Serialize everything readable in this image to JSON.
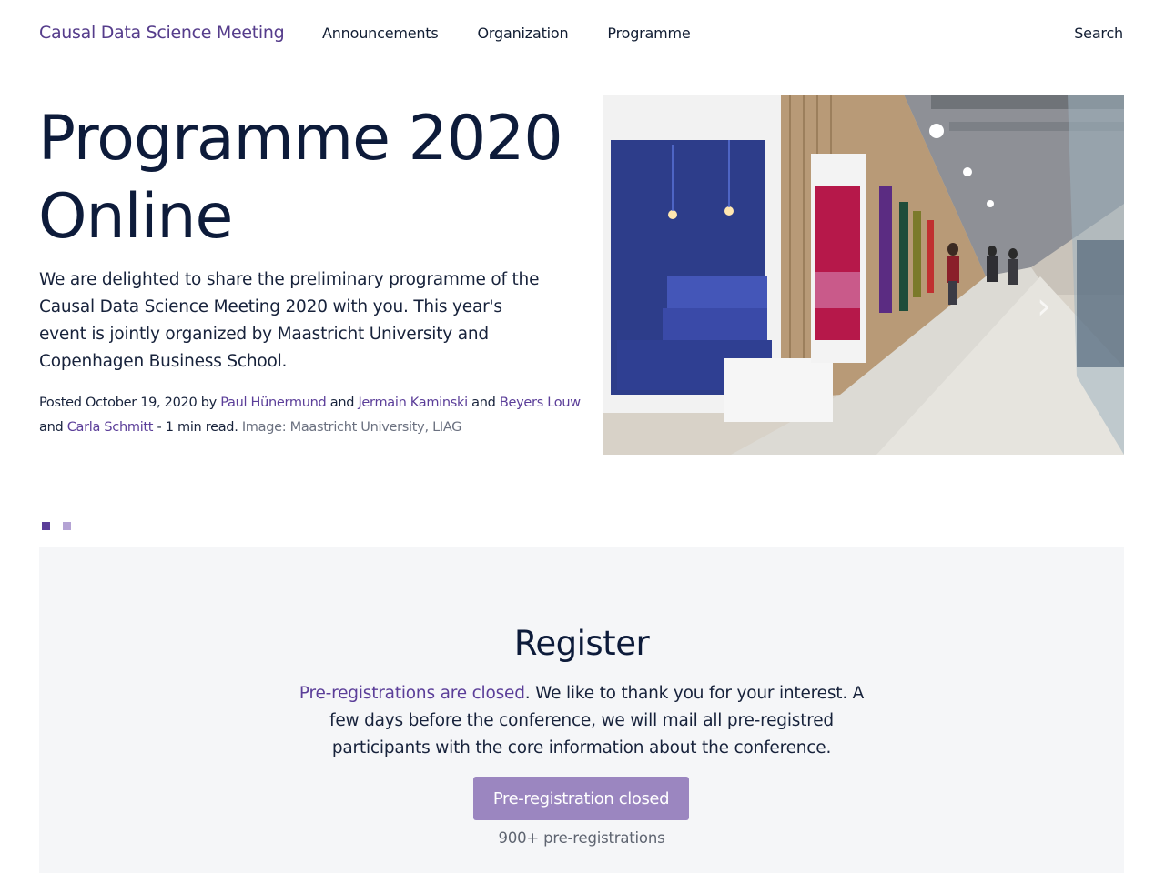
{
  "header": {
    "brand": "Causal Data Science Meeting",
    "nav": [
      "Announcements",
      "Organization",
      "Programme"
    ],
    "search": "Search"
  },
  "hero": {
    "title_line1": "Programme 2020",
    "title_line2": "Online",
    "description": "We are delighted to share the preliminary programme of the Causal Data Science Meeting 2020 with you. This year's event is jointly organized by Maastricht University and Copenhagen Business School.",
    "meta": {
      "posted": "Posted October 19, 2020 by",
      "authors": [
        "Paul Hünermund",
        "Jermain Kaminski",
        "Beyers Louw",
        "Carla Schmitt"
      ],
      "and": "and",
      "read_time": "- 1 min read.",
      "image_credit": "Image: Maastricht University, LIAG"
    },
    "next_arrow": "›"
  },
  "carousel": {
    "dot_count": 2,
    "active_index": 0
  },
  "register": {
    "title": "Register",
    "link_text": "Pre-registrations are closed",
    "text": ". We like to thank you for your interest. A few days before the conference, we will mail all pre-registred participants with the core information about the conference.",
    "button_label": "Pre-registration closed",
    "count": "900+ pre-registrations"
  },
  "colors": {
    "accent": "#5b3e99",
    "button": "#9b86c0",
    "section_bg": "#f5f6f8",
    "text": "#0d1b3a"
  }
}
